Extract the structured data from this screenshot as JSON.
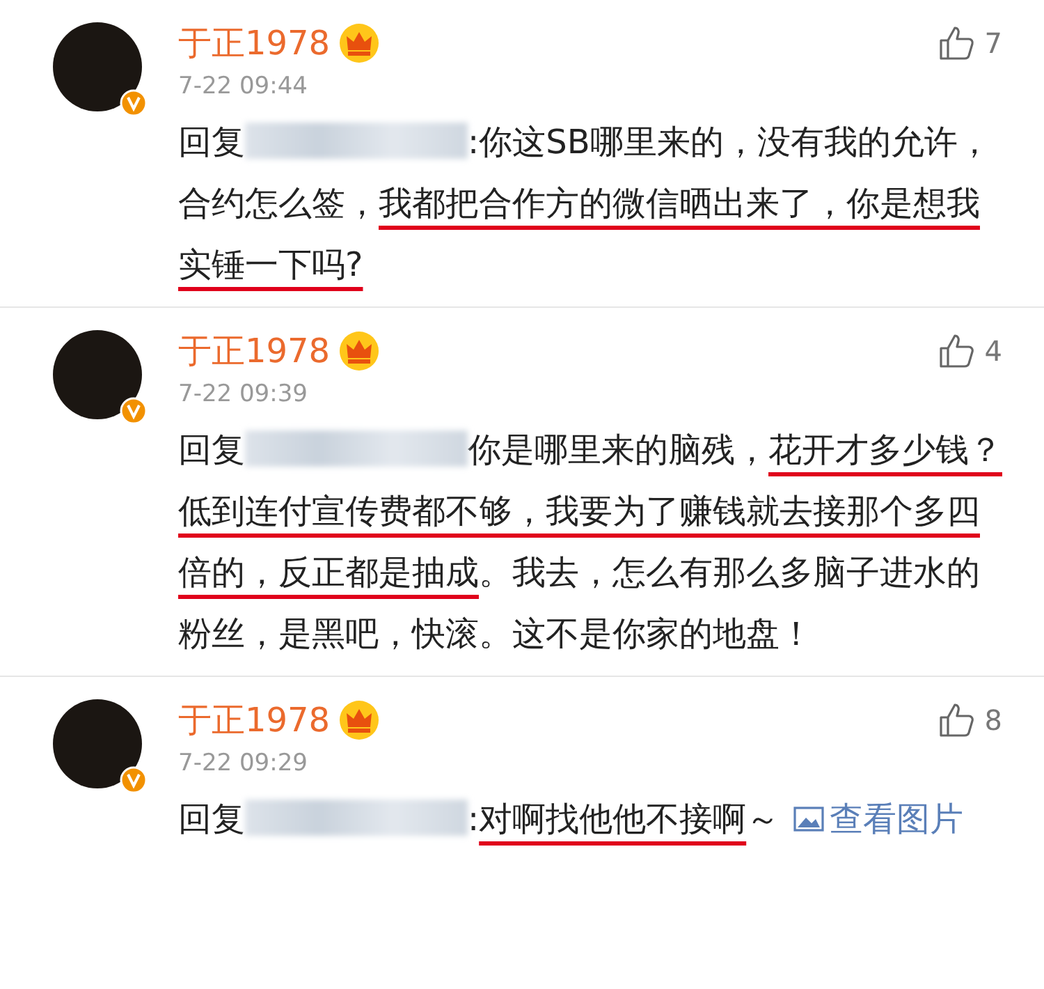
{
  "comments": [
    {
      "author": "于正1978",
      "time": "7-22 09:44",
      "likes": "7",
      "content": [
        {
          "kind": "text",
          "text": "回复"
        },
        {
          "kind": "blur"
        },
        {
          "kind": "text",
          "text": ":你这SB哪里来的，没有我的允许，合约怎么签，"
        },
        {
          "kind": "underline",
          "text": "我都把合作方的微信晒出来了，你是想我实锤一下吗?"
        }
      ]
    },
    {
      "author": "于正1978",
      "time": "7-22 09:39",
      "likes": "4",
      "content": [
        {
          "kind": "text",
          "text": "回复"
        },
        {
          "kind": "blur"
        },
        {
          "kind": "text",
          "text": "你是哪里来的脑残，"
        },
        {
          "kind": "underline",
          "text": "花开才多少钱？低到连付宣传费都不够，我要为了赚钱就去接那个多四倍的，反正都是抽成"
        },
        {
          "kind": "text",
          "text": "。我去，怎么有那么多脑子进水的粉丝，是黑吧，快滚。这不是你家的地盘！"
        }
      ]
    },
    {
      "author": "于正1978",
      "time": "7-22 09:29",
      "likes": "8",
      "content": [
        {
          "kind": "text",
          "text": "回复"
        },
        {
          "kind": "blur"
        },
        {
          "kind": "text",
          "text": ":"
        },
        {
          "kind": "underline",
          "text": "对啊找他他不接啊"
        },
        {
          "kind": "text",
          "text": "～"
        },
        {
          "kind": "link",
          "text": "查看图片"
        }
      ]
    }
  ]
}
